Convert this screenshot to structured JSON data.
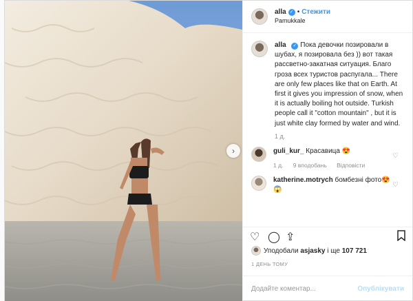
{
  "header": {
    "username": "alla",
    "verified_icon": "verified-badge-icon",
    "follow_label": "Стежити",
    "separator": "•",
    "location": "Pamukkale"
  },
  "caption": {
    "username": "alla",
    "text": "Пока девочки позировали в шубах, я позировала без )) вот такая рассветно-закатная ситуация. Благо гроза всех туристов распугала... There are only few places like that on Earth. At first it gives you impression of snow, when it is actually boiling hot outside. Turkish people call it \"cotton mountain\" , but it is just white clay formed by water and wind.",
    "time": "1 д."
  },
  "comments": [
    {
      "username": "guli_kur_",
      "text": "Красавица 😍",
      "time": "1 д.",
      "likes": "9 вподобань",
      "reply": "Відповісти"
    },
    {
      "username": "katherine.motrych",
      "text": "бомбезні фото😍😱",
      "time": "",
      "likes": "",
      "reply": ""
    }
  ],
  "likes": {
    "prefix": "Уподобали",
    "user": "asjasky",
    "middle": "і ще",
    "count": "107 721"
  },
  "timestamp": "1 ДЕНЬ ТОМУ",
  "add_comment": {
    "placeholder": "Додайте коментар...",
    "publish_label": "Опублікувати"
  },
  "colors": {
    "accent": "#3897f0",
    "publish_disabled": "#b2dffc"
  }
}
